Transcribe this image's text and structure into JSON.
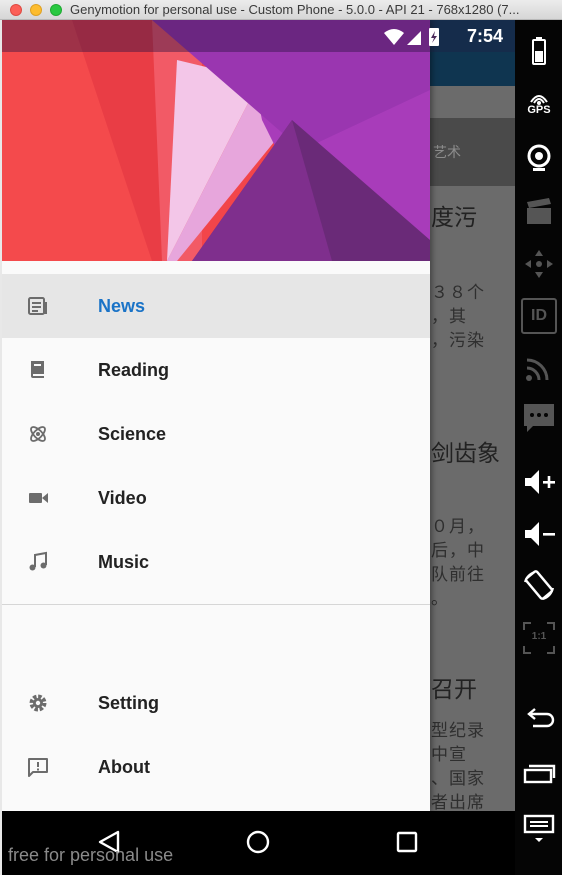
{
  "window": {
    "title": "Genymotion for personal use - Custom Phone - 5.0.0 - API 21 - 768x1280 (7..."
  },
  "status_bar": {
    "time": "7:54",
    "icons": [
      "wifi-icon",
      "signal-icon",
      "battery-charging-icon"
    ]
  },
  "drawer": {
    "menu_items": [
      {
        "label": "News",
        "icon": "news-icon",
        "active": true
      },
      {
        "label": "Reading",
        "icon": "book-icon",
        "active": false
      },
      {
        "label": "Science",
        "icon": "atom-icon",
        "active": false
      },
      {
        "label": "Video",
        "icon": "videocam-icon",
        "active": false
      },
      {
        "label": "Music",
        "icon": "music-note-icon",
        "active": false
      }
    ],
    "secondary_items": [
      {
        "label": "Setting",
        "icon": "gear-icon"
      },
      {
        "label": "About",
        "icon": "feedback-icon"
      }
    ],
    "active_color": "#1a73c7"
  },
  "background_app": {
    "tab_label": "艺术",
    "lines": [
      {
        "text": "度污",
        "kind": "title"
      },
      {
        "text": "３８个",
        "kind": "text"
      },
      {
        "text": "，其",
        "kind": "text"
      },
      {
        "text": "，污染",
        "kind": "text"
      },
      {
        "text": "剑齿象",
        "kind": "title"
      },
      {
        "text": "０月，",
        "kind": "text"
      },
      {
        "text": "后，中",
        "kind": "text"
      },
      {
        "text": "队前往",
        "kind": "text"
      },
      {
        "text": "。",
        "kind": "text"
      },
      {
        "text": "召开",
        "kind": "title"
      },
      {
        "text": "型纪录",
        "kind": "text"
      },
      {
        "text": "中宣",
        "kind": "text"
      },
      {
        "text": "、国家",
        "kind": "text"
      },
      {
        "text": "者出席",
        "kind": "text"
      }
    ]
  },
  "nav_bar": {
    "buttons": [
      "back-icon",
      "home-icon",
      "recents-icon"
    ]
  },
  "watermark": "free for personal use",
  "side_panel": {
    "buttons": [
      "battery-icon",
      "gps-icon",
      "camera-icon",
      "video-capture-icon",
      "dpad-icon",
      "id-icon",
      "rss-icon",
      "sms-icon",
      "volume-up-icon",
      "volume-down-icon",
      "rotate-icon",
      "scale-icon",
      "back-icon",
      "recents-icon",
      "menu-icon"
    ],
    "gps_label": "GPS",
    "id_label": "ID",
    "scale_label": "1:1"
  }
}
